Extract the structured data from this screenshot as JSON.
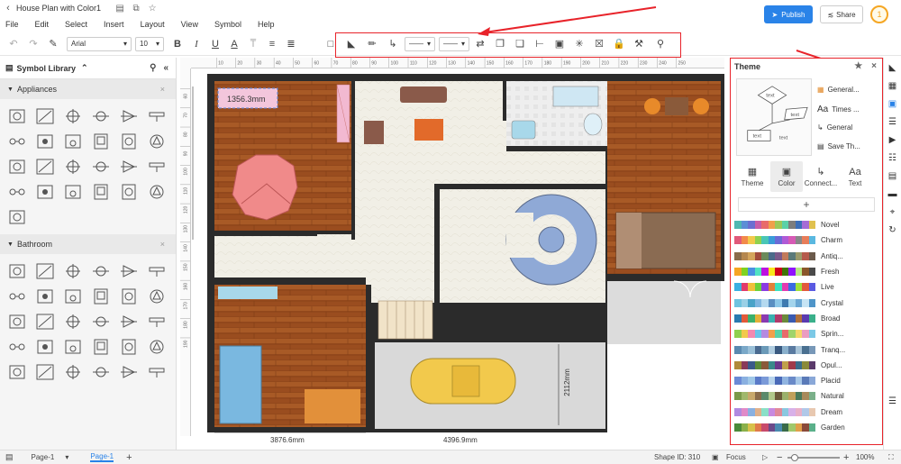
{
  "app": {
    "doc_title": "House Plan with Color1",
    "publish_label": "Publish",
    "share_label": "Share",
    "avatar_letter": "1",
    "accent_color": "#2a83e8",
    "annotation_color": "#e8232a"
  },
  "menu": [
    "File",
    "Edit",
    "Select",
    "Insert",
    "Layout",
    "View",
    "Symbol",
    "Help"
  ],
  "toolbar": {
    "font_family": "Arial",
    "font_size": "10",
    "icons": [
      "undo-icon",
      "redo-icon",
      "format-painter-icon",
      "bold-icon",
      "italic-icon",
      "underline-icon",
      "font-color-icon",
      "text-style-icon",
      "align-icon",
      "spacing-icon",
      "text-box-icon",
      "fill-icon",
      "line-color-icon",
      "connector-icon",
      "line-style-icon",
      "line-weight-icon",
      "arrow-style-icon",
      "bring-front-icon",
      "send-back-icon",
      "align-shapes-icon",
      "group-icon",
      "distribute-icon",
      "edit-shape-icon",
      "lock-icon",
      "tools-icon",
      "search-icon"
    ]
  },
  "left_panel": {
    "title": "Symbol Library",
    "categories": [
      {
        "name": "Appliances"
      },
      {
        "name": "Bathroom"
      }
    ]
  },
  "canvas": {
    "selected_label": "1356.3mm",
    "dim_bottom_left": "3876.6mm",
    "dim_bottom_right": "4396.9mm",
    "dim_vertical": "2112mm",
    "ruler_top": [
      "10",
      "20",
      "30",
      "40",
      "50",
      "60",
      "70",
      "80",
      "90",
      "100",
      "110",
      "120",
      "130",
      "140",
      "150",
      "160",
      "170",
      "180",
      "190",
      "200",
      "210",
      "220",
      "230",
      "240",
      "250"
    ],
    "ruler_left": [
      "60",
      "70",
      "80",
      "90",
      "100",
      "110",
      "120",
      "130",
      "140",
      "150",
      "160",
      "170",
      "180",
      "190"
    ]
  },
  "right_panel": {
    "title": "Theme",
    "options": [
      {
        "icon": "general-icon",
        "label": "General..."
      },
      {
        "icon": "font-icon",
        "label": "Times ..."
      },
      {
        "icon": "connector-icon",
        "label": "General"
      },
      {
        "icon": "save-icon",
        "label": "Save Th..."
      }
    ],
    "preview_labels": [
      "text",
      "text",
      "text",
      "text"
    ],
    "tabs": [
      {
        "icon": "theme-icon",
        "label": "Theme"
      },
      {
        "icon": "color-icon",
        "label": "Color",
        "active": true
      },
      {
        "icon": "connector-icon",
        "label": "Connect..."
      },
      {
        "icon": "text-icon",
        "label": "Text"
      }
    ],
    "add_label": "+",
    "palettes": [
      {
        "name": "Novel",
        "colors": [
          "#4fb8b1",
          "#5c8ed6",
          "#6b6fd1",
          "#c85ea8",
          "#e86b6b",
          "#f0a04b",
          "#9cc95a",
          "#5ad1a8",
          "#7d7d7d",
          "#3c6fb8",
          "#a66bd6",
          "#e0c14f"
        ]
      },
      {
        "name": "Charm",
        "colors": [
          "#e05a7a",
          "#f28a4a",
          "#f2c94c",
          "#8fd14f",
          "#49c6b6",
          "#3a9bd9",
          "#6b6bd6",
          "#b05ad6",
          "#d65ab5",
          "#888888",
          "#e87d5a",
          "#5ab8e0"
        ]
      },
      {
        "name": "Antiq...",
        "colors": [
          "#8a6d4b",
          "#b5874f",
          "#d4a55c",
          "#a04b3c",
          "#6b8a5a",
          "#4b6b8a",
          "#7a5a8a",
          "#c27a5a",
          "#5a7a7a",
          "#9a9a6b",
          "#b55a4b",
          "#6b5a4b"
        ]
      },
      {
        "name": "Fresh",
        "colors": [
          "#f5a623",
          "#7ed321",
          "#4a90e2",
          "#50e3c2",
          "#bd10e0",
          "#f8e71c",
          "#d0021b",
          "#417505",
          "#9013fe",
          "#b8e986",
          "#8b572a",
          "#4a4a4a"
        ]
      },
      {
        "name": "Live",
        "colors": [
          "#3ab0e2",
          "#e23a6b",
          "#f0c03a",
          "#6bd13a",
          "#8a3ae2",
          "#e2803a",
          "#3ae2c0",
          "#e23ab0",
          "#3a6be2",
          "#a0e23a",
          "#e25a3a",
          "#5a5ae2"
        ]
      },
      {
        "name": "Crystal",
        "colors": [
          "#6fc3df",
          "#9ad0e6",
          "#4aa3c8",
          "#7fb6e0",
          "#b4d9ef",
          "#5a8fc2",
          "#8cc7e8",
          "#3e7ab0",
          "#a3d4ec",
          "#6aa8d4",
          "#c6e4f4",
          "#4f95c9"
        ]
      },
      {
        "name": "Broad",
        "colors": [
          "#2a7ab0",
          "#e25a3a",
          "#3ab06b",
          "#e2b03a",
          "#8a3ab0",
          "#3ab0b0",
          "#b03a6b",
          "#6b8a3a",
          "#3a5ab0",
          "#b0703a",
          "#5a3ab0",
          "#3ab08a"
        ]
      },
      {
        "name": "Sprin...",
        "colors": [
          "#8fd14f",
          "#f2c94c",
          "#f28ab0",
          "#6bc4e8",
          "#b48ae0",
          "#f2a04b",
          "#5ad1a8",
          "#e86b6b",
          "#a0d46b",
          "#f5d76b",
          "#ea9cc2",
          "#7cc9e6"
        ]
      },
      {
        "name": "Tranq...",
        "colors": [
          "#5a8ab0",
          "#7aa8c8",
          "#9ac0d8",
          "#4a6a90",
          "#6b9ab8",
          "#b0cde0",
          "#3a5a80",
          "#8ab0cc",
          "#5a7aa0",
          "#a8c4d8",
          "#4a7090",
          "#7898b8"
        ]
      },
      {
        "name": "Opul...",
        "colors": [
          "#b08a3a",
          "#8a3a5a",
          "#3a5a8a",
          "#5a8a3a",
          "#8a5a3a",
          "#3a8a8a",
          "#6b3a8a",
          "#c0a04a",
          "#a03a4a",
          "#3a6b8a",
          "#8a8a3a",
          "#5a3a6b"
        ]
      },
      {
        "name": "Placid",
        "colors": [
          "#6b8ad6",
          "#8ab0e0",
          "#a0c8e8",
          "#5a7ac8",
          "#7a9ad8",
          "#b8d4ec",
          "#4a6ab8",
          "#90b4e0",
          "#6a8ac8",
          "#a8c8e8",
          "#5a7ab8",
          "#8aa8d8"
        ]
      },
      {
        "name": "Natural",
        "colors": [
          "#7a9a4a",
          "#a0b86b",
          "#c8a86b",
          "#8a6b4a",
          "#5a8a6b",
          "#b0c88a",
          "#6b5a3a",
          "#9ab06b",
          "#c0a05a",
          "#4a7a5a",
          "#a88a5a",
          "#7ab08a"
        ]
      },
      {
        "name": "Dream",
        "colors": [
          "#b08ae0",
          "#e08ac8",
          "#8ab0e0",
          "#e0b08a",
          "#8ae0c8",
          "#c88ae0",
          "#e08a9a",
          "#8ac8e0",
          "#d8b0e8",
          "#e8b0c8",
          "#b0c8e8",
          "#e8c8b0"
        ]
      },
      {
        "name": "Garden",
        "colors": [
          "#4a8a3a",
          "#8ab04a",
          "#d8c04a",
          "#e07a4a",
          "#c84a6b",
          "#6b4a8a",
          "#4a8ab0",
          "#3a6b4a",
          "#a0c86b",
          "#e0a04a",
          "#8a4a3a",
          "#5ab08a"
        ]
      }
    ]
  },
  "far_right": [
    "fill-icon",
    "image-icon",
    "theme-icon",
    "layers-icon",
    "presentation-icon",
    "data-icon",
    "picture-icon",
    "outline-icon",
    "fit-icon",
    "history-icon",
    "expand-icon"
  ],
  "status": {
    "page_dropdown": "Page-1",
    "page_tab": "Page-1",
    "add_page": "+",
    "shape_id": "Shape ID: 310",
    "focus": "Focus",
    "zoom": "100%"
  }
}
